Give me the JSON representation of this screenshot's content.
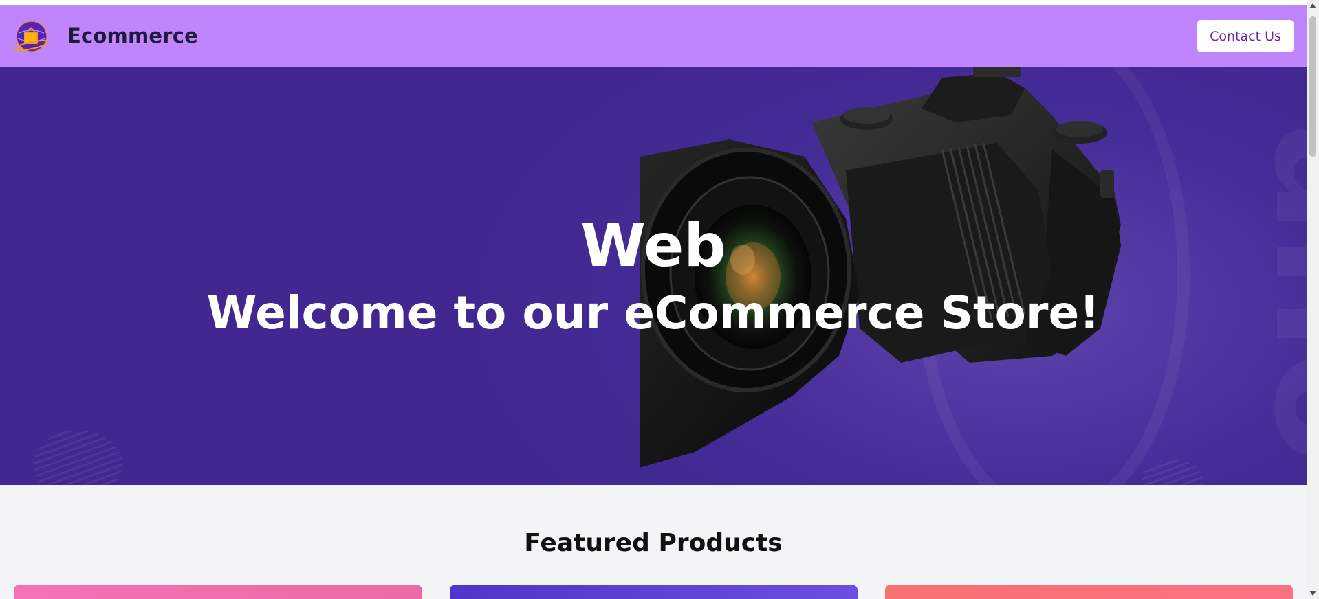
{
  "navbar": {
    "brand": "Ecommerce",
    "logo_icon": "globe-shopping-bag-icon",
    "contact_label": "Contact Us"
  },
  "hero": {
    "title": "Web",
    "subtitle": "Welcome to our eCommerce Store!",
    "image_icon": "camera-icon"
  },
  "featured": {
    "title": "Featured Products"
  },
  "colors": {
    "navbar_bg": "#c084fc",
    "hero_bg": "#41278f",
    "accent_text": "#6b21a8",
    "section_bg": "#f3f4f6"
  }
}
